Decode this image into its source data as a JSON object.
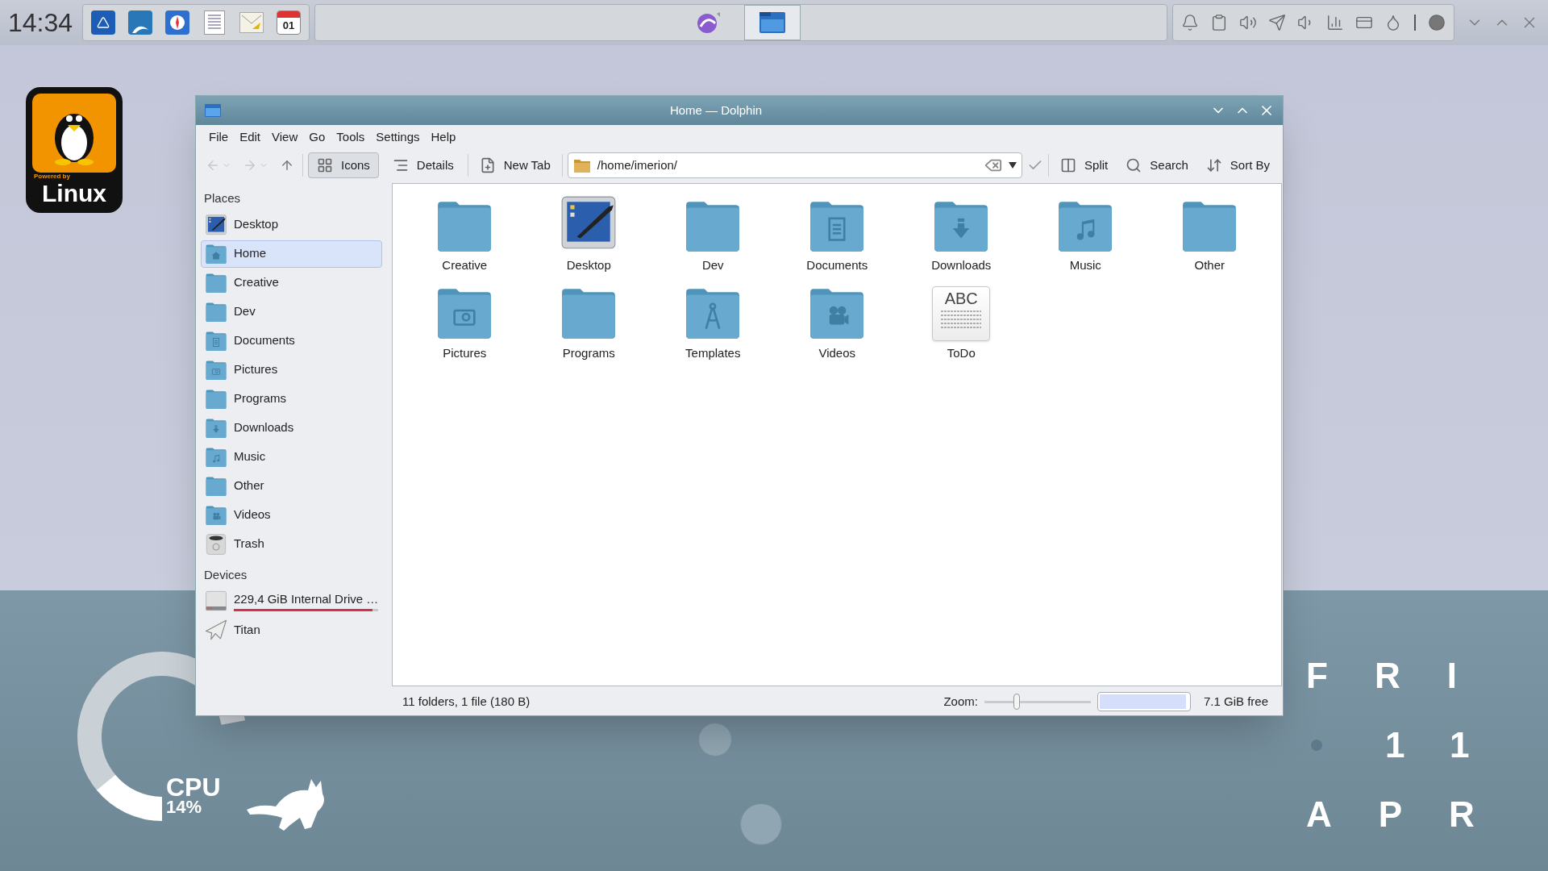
{
  "taskbar": {
    "clock": "14:34",
    "launchers": [
      {
        "kind": "kde"
      },
      {
        "kind": "dolphin"
      },
      {
        "kind": "compass"
      },
      {
        "kind": "document"
      },
      {
        "kind": "mail"
      },
      {
        "kind": "calendar",
        "label": "01"
      }
    ],
    "tasks": [
      {
        "kind": "chat",
        "selected": false
      },
      {
        "kind": "files",
        "selected": true
      }
    ],
    "tray": [
      {
        "kind": "bell"
      },
      {
        "kind": "clipboard"
      },
      {
        "kind": "volume"
      },
      {
        "kind": "plane"
      },
      {
        "kind": "speaker"
      },
      {
        "kind": "signal"
      },
      {
        "kind": "card"
      },
      {
        "kind": "drop"
      },
      {
        "kind": "bar"
      },
      {
        "kind": "circle"
      }
    ],
    "controls": [
      {
        "kind": "down"
      },
      {
        "kind": "up"
      },
      {
        "kind": "close"
      }
    ]
  },
  "logo": {
    "caption": "Powered by",
    "name": "Linux"
  },
  "window": {
    "title": "Home — Dolphin",
    "menu": [
      "File",
      "Edit",
      "View",
      "Go",
      "Tools",
      "Settings",
      "Help"
    ],
    "nav": [
      {
        "kind": "back",
        "disabled": true
      },
      {
        "kind": "forward",
        "disabled": true
      },
      {
        "kind": "up",
        "disabled": false
      }
    ],
    "view_modes": [
      {
        "kind": "icons",
        "label": "Icons",
        "selected": true
      },
      {
        "kind": "details",
        "label": "Details",
        "selected": false
      }
    ],
    "new_tab": "New Tab",
    "location": "/home/imerion/",
    "actions": [
      {
        "kind": "split",
        "label": "Split"
      },
      {
        "kind": "search",
        "label": "Search"
      },
      {
        "kind": "sort",
        "label": "Sort By"
      }
    ],
    "places": {
      "heading": "Places",
      "items": [
        {
          "label": "Desktop",
          "kind": "desktop",
          "selected": false
        },
        {
          "label": "Home",
          "kind": "home",
          "selected": true
        },
        {
          "label": "Creative",
          "kind": "folder",
          "selected": false
        },
        {
          "label": "Dev",
          "kind": "folder",
          "selected": false
        },
        {
          "label": "Documents",
          "kind": "documents",
          "selected": false
        },
        {
          "label": "Pictures",
          "kind": "pictures",
          "selected": false
        },
        {
          "label": "Programs",
          "kind": "folder",
          "selected": false
        },
        {
          "label": "Downloads",
          "kind": "downloads",
          "selected": false
        },
        {
          "label": "Music",
          "kind": "music",
          "selected": false
        },
        {
          "label": "Other",
          "kind": "folder",
          "selected": false
        },
        {
          "label": "Videos",
          "kind": "videos",
          "selected": false
        },
        {
          "label": "Trash",
          "kind": "trash",
          "selected": false
        }
      ]
    },
    "devices": {
      "heading": "Devices",
      "items": [
        {
          "label": "229,4 GiB Internal Drive …",
          "kind": "drive",
          "level": 0.96
        },
        {
          "label": "Titan",
          "kind": "plane"
        }
      ]
    },
    "items": [
      {
        "label": "Creative",
        "kind": "folder"
      },
      {
        "label": "Desktop",
        "kind": "desktop"
      },
      {
        "label": "Dev",
        "kind": "folder"
      },
      {
        "label": "Documents",
        "kind": "documents"
      },
      {
        "label": "Downloads",
        "kind": "downloads"
      },
      {
        "label": "Music",
        "kind": "music"
      },
      {
        "label": "Other",
        "kind": "folder"
      },
      {
        "label": "Pictures",
        "kind": "pictures"
      },
      {
        "label": "Programs",
        "kind": "folder"
      },
      {
        "label": "Templates",
        "kind": "templates"
      },
      {
        "label": "Videos",
        "kind": "videos"
      },
      {
        "label": "ToDo",
        "kind": "text",
        "preview": "ABC"
      }
    ],
    "status": {
      "summary": "11 folders, 1 file (180 B)",
      "zoom_label": "Zoom:",
      "zoom": {
        "level": 0.3
      },
      "space": {
        "level": 0.97
      },
      "free": "7.1 GiB free"
    }
  },
  "cpu": {
    "label": "CPU",
    "reading": "14%",
    "level": 0.14
  },
  "date": {
    "day": "FRI",
    "date": "11",
    "month": "APR"
  }
}
